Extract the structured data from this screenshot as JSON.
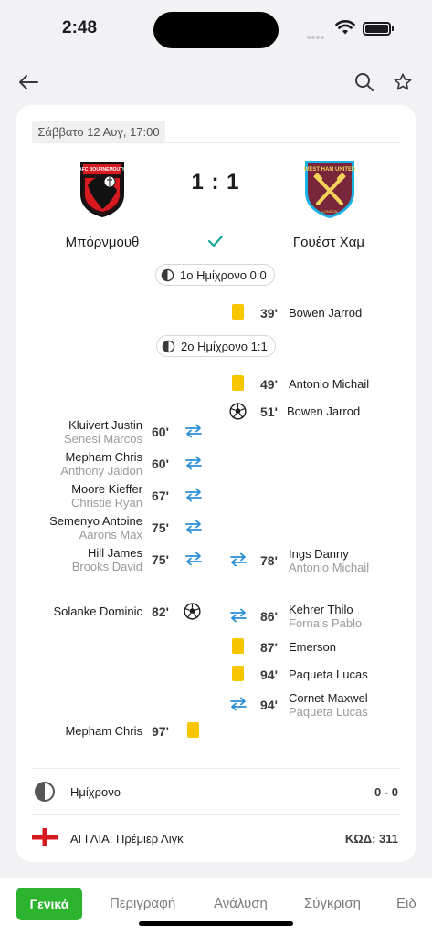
{
  "status": {
    "time": "2:48"
  },
  "match": {
    "date": "Σάββατο 12 Αυγ, 17:00",
    "score": "1 : 1",
    "home_team": "Μπόρνμουθ",
    "away_team": "Γουέστ Χαμ",
    "home_crest_text": "AFC BOURNEMOUTH",
    "away_crest_text": "WEST HAM UNITED",
    "away_crest_sub": "LONDON"
  },
  "halves": {
    "first": "1ο Ημίχρονο 0:0",
    "second": "2ο Ημίχρονο 1:1"
  },
  "events": {
    "e1": {
      "minute": "39'",
      "player": "Bowen Jarrod"
    },
    "e2": {
      "minute": "49'",
      "player": "Antonio Michail"
    },
    "e3": {
      "minute": "51'",
      "player": "Bowen Jarrod"
    },
    "e4": {
      "minute": "60'",
      "player": "Kluivert Justin",
      "sub": "Senesi Marcos"
    },
    "e5": {
      "minute": "60'",
      "player": "Mepham Chris",
      "sub": "Anthony Jaidon"
    },
    "e6": {
      "minute": "67'",
      "player": "Moore Kieffer",
      "sub": "Christie Ryan"
    },
    "e7": {
      "minute": "75'",
      "player": "Semenyo Antoine",
      "sub": "Aarons Max"
    },
    "e8": {
      "minute": "75'",
      "player": "Hill James",
      "sub": "Brooks David"
    },
    "e9": {
      "minute": "78'",
      "player": "Ings Danny",
      "sub": "Antonio Michail"
    },
    "e10": {
      "minute": "82'",
      "player": "Solanke Dominic"
    },
    "e11": {
      "minute": "86'",
      "player": "Kehrer Thilo",
      "sub": "Fornals Pablo"
    },
    "e12": {
      "minute": "87'",
      "player": "Emerson"
    },
    "e13": {
      "minute": "94'",
      "player": "Paqueta Lucas"
    },
    "e14": {
      "minute": "94'",
      "player": "Cornet Maxwel",
      "sub": "Paqueta Lucas"
    },
    "e15": {
      "minute": "97'",
      "player": "Mepham Chris"
    }
  },
  "footer": {
    "halftime_label": "Ημίχρονο",
    "halftime_score": "0 - 0",
    "league": "ΑΓΓΛΙΑ: Πρέμιερ Λιγκ",
    "code": "ΚΩΔ: 311"
  },
  "tabs": [
    "Γενικά",
    "Περιγραφή",
    "Ανάλυση",
    "Σύγκριση",
    "Ειδ"
  ],
  "colors": {
    "accent_green": "#2db42f",
    "check_teal": "#1aa89a",
    "sub_blue": "#2a8fd6",
    "yellow_card": "#f7c600",
    "bournemouth_red": "#d71920",
    "westham_claret": "#7a263a"
  }
}
